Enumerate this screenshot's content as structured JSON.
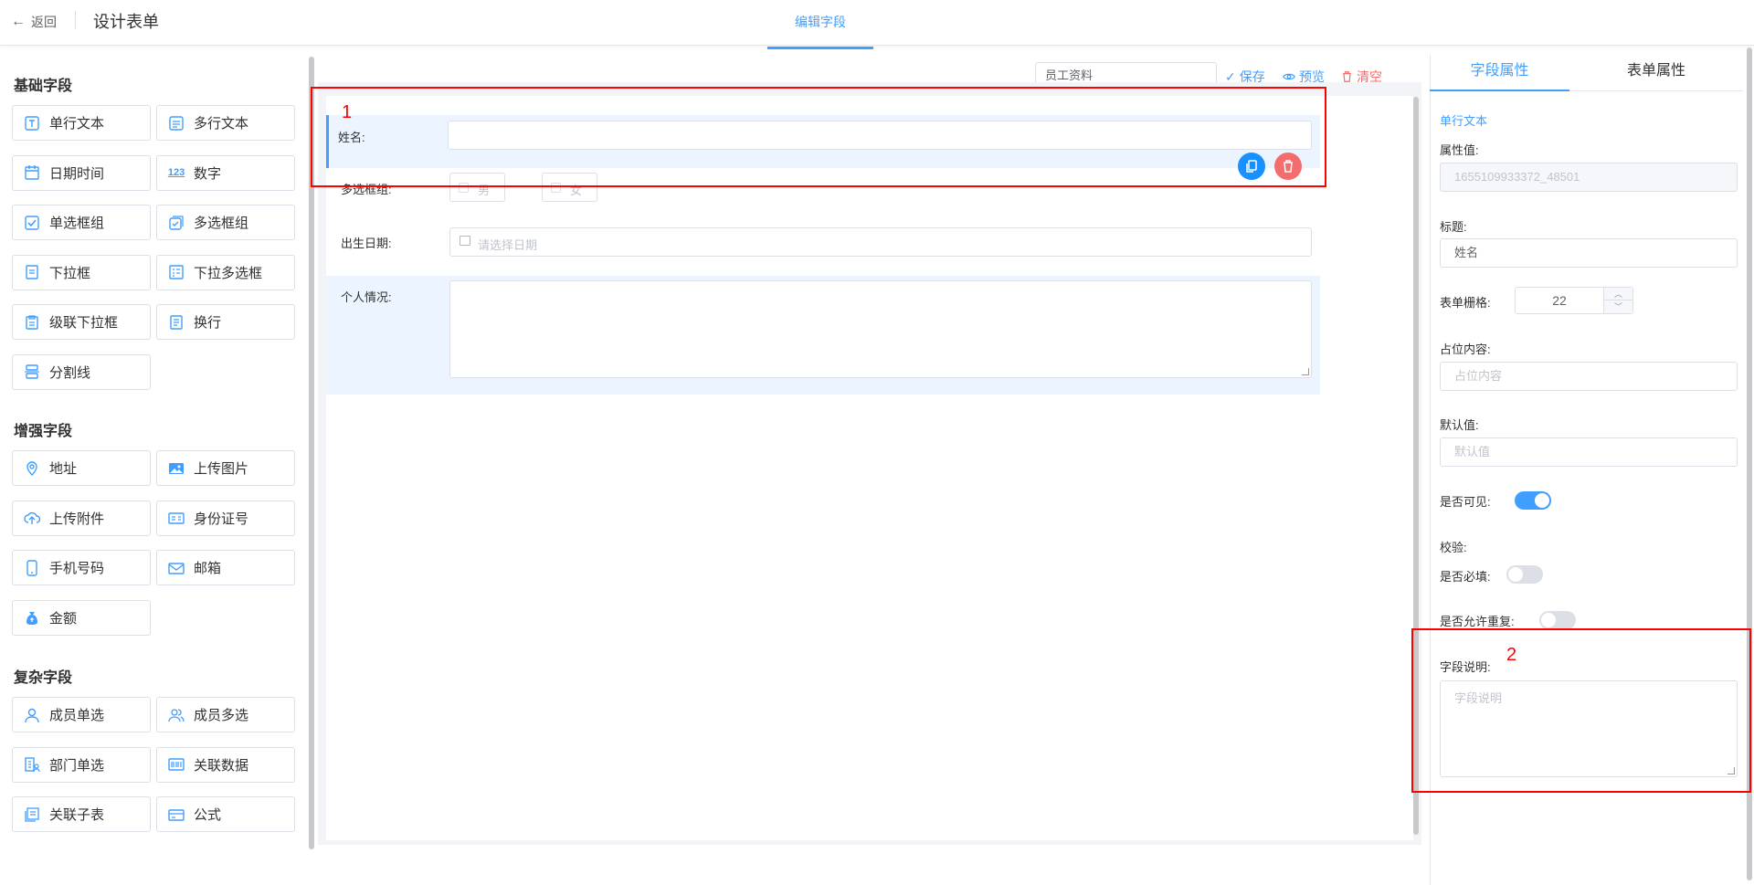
{
  "header": {
    "back_label": "返回",
    "title": "设计表单",
    "active_tab": "编辑字段"
  },
  "palette": {
    "basic_title": "基础字段",
    "basic": [
      {
        "label": "单行文本",
        "icon": "text-input-icon"
      },
      {
        "label": "多行文本",
        "icon": "textarea-icon"
      },
      {
        "label": "日期时间",
        "icon": "calendar-icon"
      },
      {
        "label": "数字",
        "icon": "number-icon",
        "icon_text": "123"
      },
      {
        "label": "单选框组",
        "icon": "radio-icon"
      },
      {
        "label": "多选框组",
        "icon": "checkbox-group-icon"
      },
      {
        "label": "下拉框",
        "icon": "select-icon"
      },
      {
        "label": "下拉多选框",
        "icon": "multi-select-icon"
      },
      {
        "label": "级联下拉框",
        "icon": "cascader-icon"
      },
      {
        "label": "换行",
        "icon": "line-break-icon"
      },
      {
        "label": "分割线",
        "icon": "divider-icon"
      }
    ],
    "enhanced_title": "增强字段",
    "enhanced": [
      {
        "label": "地址",
        "icon": "location-icon"
      },
      {
        "label": "上传图片",
        "icon": "image-icon"
      },
      {
        "label": "上传附件",
        "icon": "upload-cloud-icon"
      },
      {
        "label": "身份证号",
        "icon": "id-card-icon"
      },
      {
        "label": "手机号码",
        "icon": "mobile-icon"
      },
      {
        "label": "邮箱",
        "icon": "mail-icon"
      },
      {
        "label": "金额",
        "icon": "money-bag-icon"
      }
    ],
    "complex_title": "复杂字段",
    "complex": [
      {
        "label": "成员单选",
        "icon": "user-icon"
      },
      {
        "label": "成员多选",
        "icon": "users-icon"
      },
      {
        "label": "部门单选",
        "icon": "department-icon"
      },
      {
        "label": "关联数据",
        "icon": "barcode-icon"
      },
      {
        "label": "关联子表",
        "icon": "sub-table-icon"
      },
      {
        "label": "公式",
        "icon": "formula-icon"
      }
    ]
  },
  "toolbar": {
    "form_name": "员工资料",
    "save_label": "保存",
    "preview_label": "预览",
    "clear_label": "清空"
  },
  "form": {
    "name_label": "姓名:",
    "checkbox_label": "多选框组:",
    "checkbox_options": [
      "男",
      "女"
    ],
    "birth_label": "出生日期:",
    "birth_placeholder": "请选择日期",
    "intro_label": "个人情况:"
  },
  "annotations": {
    "box1": "1",
    "box2": "2"
  },
  "properties": {
    "tab_field": "字段属性",
    "tab_form": "表单属性",
    "field_type": "单行文本",
    "attr_value_label": "属性值:",
    "attr_value": "1655109933372_48501",
    "title_label": "标题:",
    "title_value": "姓名",
    "grid_label": "表单栅格:",
    "grid_value": "22",
    "placeholder_label": "占位内容:",
    "placeholder_hint": "占位内容",
    "default_label": "默认值:",
    "default_hint": "默认值",
    "visible_label": "是否可见:",
    "visible": true,
    "validate_label": "校验:",
    "required_label": "是否必填:",
    "required": false,
    "repeat_label": "是否允许重复:",
    "repeat": false,
    "desc_label": "字段说明:",
    "desc_hint": "字段说明"
  },
  "colors": {
    "accent": "#409eff",
    "danger": "#f56c6c",
    "annotation": "#ff0000"
  }
}
